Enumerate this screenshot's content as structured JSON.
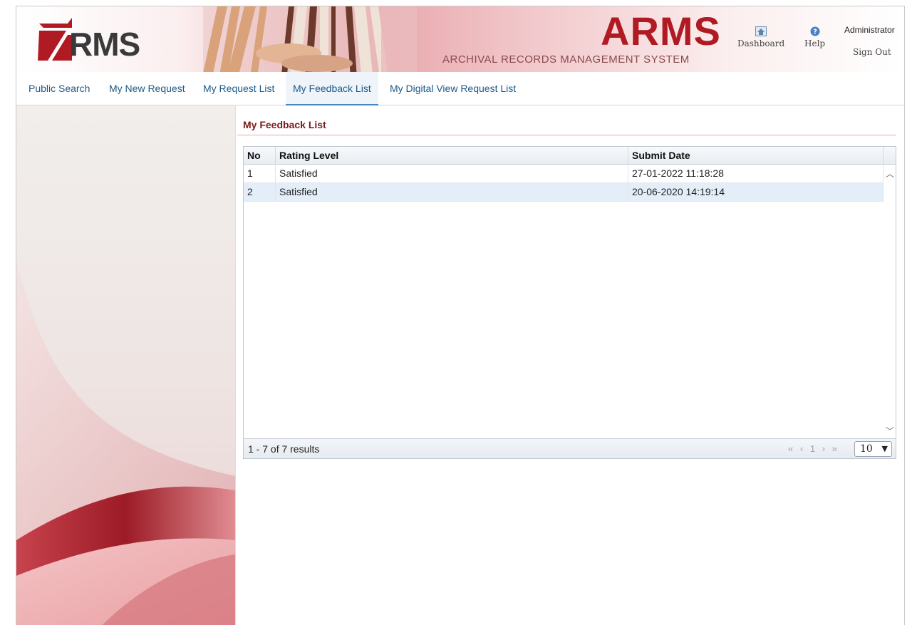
{
  "header": {
    "logo_text": "RMS",
    "brand_title": "ARMS",
    "brand_subtitle": "ARCHIVAL RECORDS MANAGEMENT SYSTEM",
    "dashboard_label": "Dashboard",
    "help_label": "Help",
    "user_name": "Administrator",
    "signout_label": "Sign Out"
  },
  "nav": {
    "tabs": [
      {
        "label": "Public Search"
      },
      {
        "label": "My New Request"
      },
      {
        "label": "My Request List"
      },
      {
        "label": "My Feedback List",
        "active": true
      },
      {
        "label": "My Digital View Request List"
      }
    ]
  },
  "main": {
    "title": "My Feedback List",
    "grid": {
      "columns": [
        "No",
        "Rating Level",
        "Submit Date"
      ],
      "rows": [
        {
          "no": "1",
          "rating": "Satisfied",
          "date": "27-01-2022 11:18:28"
        },
        {
          "no": "2",
          "rating": "Satisfied",
          "date": "20-06-2020 14:19:14"
        }
      ],
      "results_text": "1 - 7 of 7 results",
      "pager": {
        "first": "«",
        "prev": "‹",
        "page": "1",
        "next": "›",
        "last": "»"
      },
      "page_size": "10"
    }
  },
  "colors": {
    "brand": "#b01a22",
    "title": "#7a1a1a",
    "nav_text": "#1a5a8a",
    "row_alt": "#e3eef8"
  }
}
